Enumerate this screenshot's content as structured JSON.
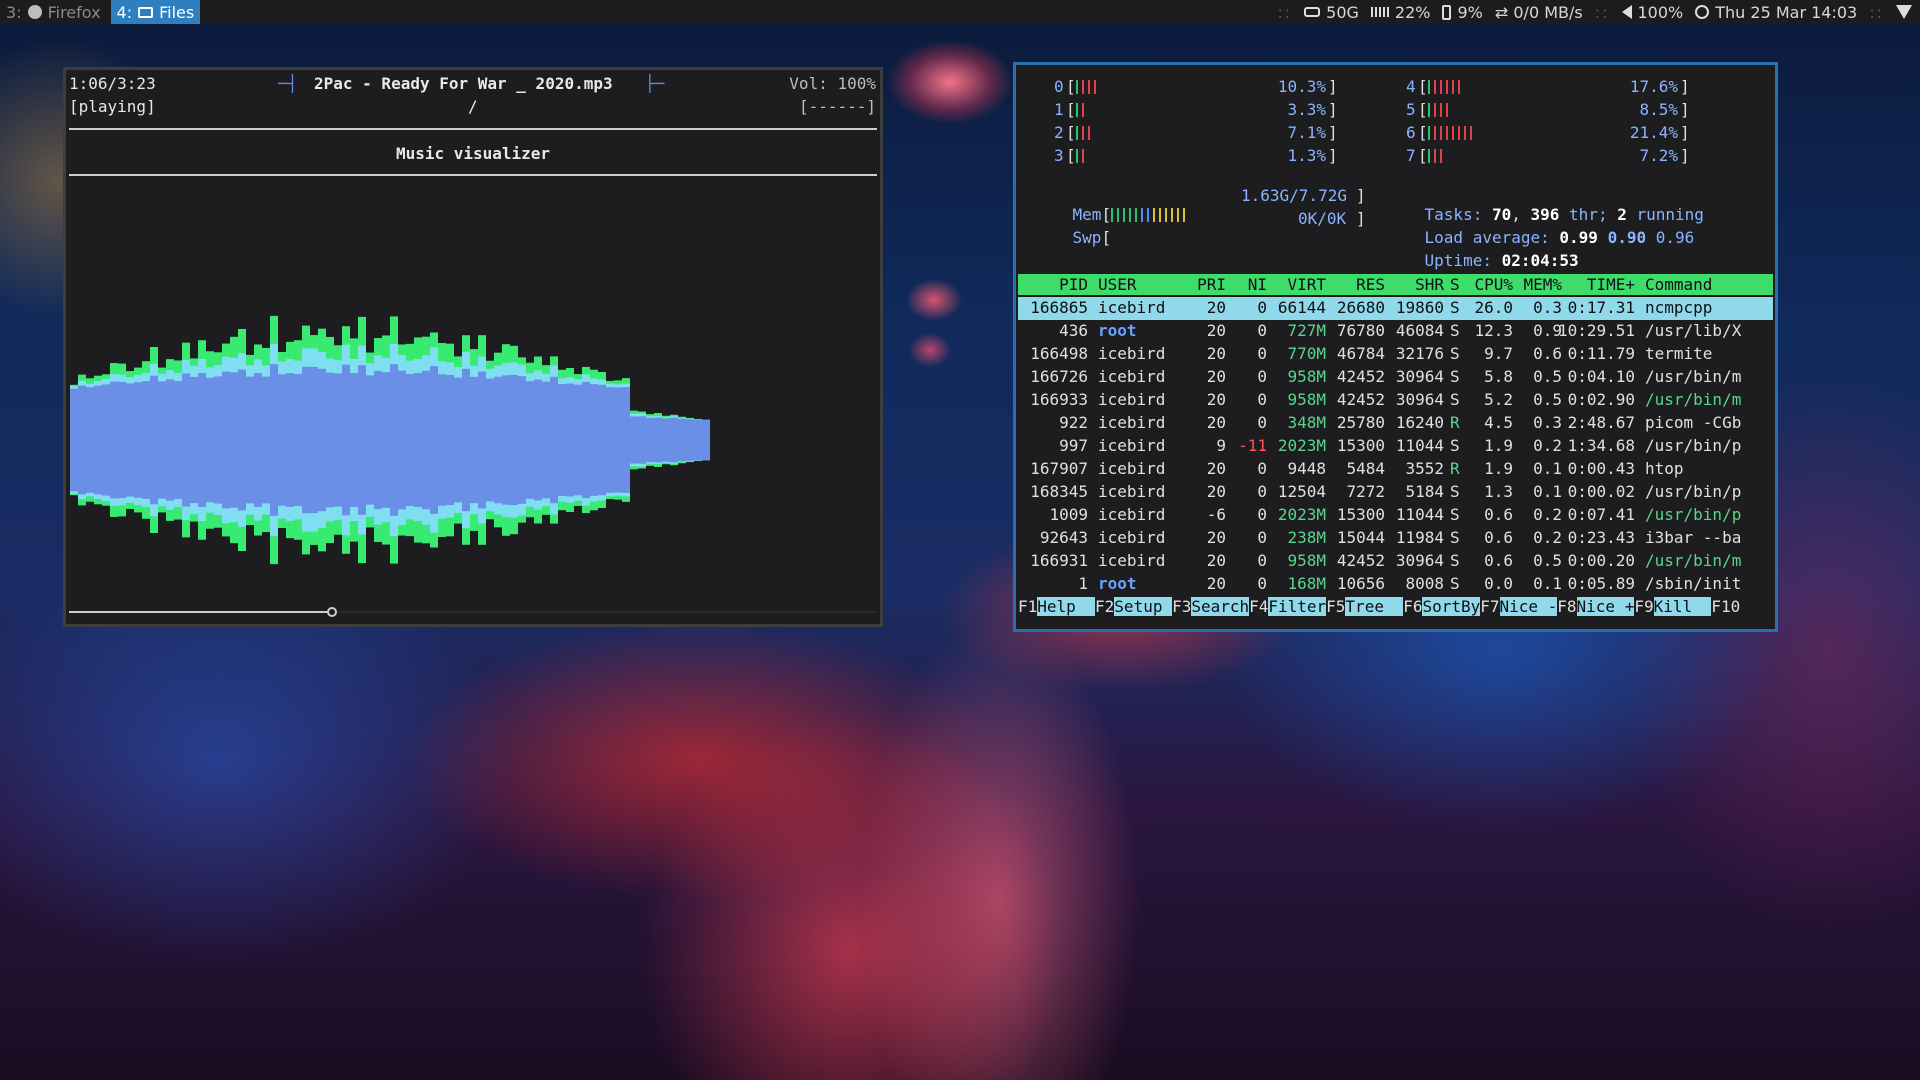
{
  "topbar": {
    "workspaces": [
      {
        "num": "3:",
        "label": "Firefox",
        "icon": "firefox-icon",
        "active": false
      },
      {
        "num": "4:",
        "label": "Files",
        "icon": "folder-icon",
        "active": true
      }
    ],
    "status": {
      "disk": "50G",
      "memory": "22%",
      "battery": "9%",
      "network": "⇄ 0/0 MB/s",
      "volume": "100%",
      "clock": "Thu 25 Mar 14:03"
    }
  },
  "ncmpcpp": {
    "elapsed": "1:06/3:23",
    "state": "[playing]",
    "title": "2Pac - Ready For War _ 2020.mp3",
    "title_left_deco": "─┤",
    "title_right_deco": "├─",
    "volume": "Vol: 100%",
    "slash": "/",
    "flags": "[------]",
    "section_title": "Music visualizer",
    "progress": 0.326,
    "colors": {
      "inner": "#6b8fe6",
      "mid": "#7fdff0",
      "outer": "#39ea72"
    }
  },
  "htop": {
    "cpus_left": [
      {
        "id": "0",
        "bars": [
          "g",
          "r",
          "r",
          "r"
        ],
        "pct": "10.3%"
      },
      {
        "id": "1",
        "bars": [
          "g",
          "r"
        ],
        "pct": "3.3%"
      },
      {
        "id": "2",
        "bars": [
          "g",
          "r",
          "r"
        ],
        "pct": "7.1%"
      },
      {
        "id": "3",
        "bars": [
          "g",
          "r"
        ],
        "pct": "1.3%"
      }
    ],
    "cpus_right": [
      {
        "id": "4",
        "bars": [
          "g",
          "r",
          "r",
          "r",
          "r",
          "r"
        ],
        "pct": "17.6%"
      },
      {
        "id": "5",
        "bars": [
          "g",
          "r",
          "r",
          "r"
        ],
        "pct": "8.5%"
      },
      {
        "id": "6",
        "bars": [
          "g",
          "r",
          "r",
          "r",
          "r",
          "r",
          "r",
          "r"
        ],
        "pct": "21.4%"
      },
      {
        "id": "7",
        "bars": [
          "g",
          "r",
          "r"
        ],
        "pct": "7.2%"
      }
    ],
    "mem": {
      "label": "Mem",
      "bars": [
        "g",
        "g",
        "g",
        "g",
        "g",
        "b",
        "b",
        "y",
        "y",
        "y",
        "y",
        "y",
        "y"
      ],
      "value": "1.63G/7.72G"
    },
    "swp": {
      "label": "Swp",
      "value": "0K/0K"
    },
    "tasks": {
      "label": "Tasks:",
      "count": "70",
      "thr": "396",
      "thr_label": "thr;",
      "running": "2",
      "running_label": "running"
    },
    "load": {
      "label": "Load average:",
      "v1": "0.99",
      "v2": "0.90",
      "v3": "0.96"
    },
    "uptime": {
      "label": "Uptime:",
      "value": "02:04:53"
    },
    "headers": [
      "PID",
      "USER",
      "PRI",
      "NI",
      "VIRT",
      "RES",
      "SHR",
      "S",
      "CPU%",
      "MEM%",
      "TIME+",
      "Command"
    ],
    "processes": [
      {
        "pid": "166865",
        "user": "icebird",
        "pri": "20",
        "ni": "0",
        "virt": "66144",
        "res": "26680",
        "shr": "19860",
        "s": "S",
        "cpu": "26.0",
        "mem": "0.3",
        "time": "0:17.31",
        "cmd": "ncmpcpp",
        "selected": true
      },
      {
        "pid": "436",
        "user": "root",
        "pri": "20",
        "ni": "0",
        "virt": "727M",
        "res": "76780",
        "shr": "46084",
        "s": "S",
        "cpu": "12.3",
        "mem": "0.9",
        "time": "10:29.51",
        "cmd": "/usr/lib/X"
      },
      {
        "pid": "166498",
        "user": "icebird",
        "pri": "20",
        "ni": "0",
        "virt": "770M",
        "res": "46784",
        "shr": "32176",
        "s": "S",
        "cpu": "9.7",
        "mem": "0.6",
        "time": "0:11.79",
        "cmd": "termite"
      },
      {
        "pid": "166726",
        "user": "icebird",
        "pri": "20",
        "ni": "0",
        "virt": "958M",
        "res": "42452",
        "shr": "30964",
        "s": "S",
        "cpu": "5.8",
        "mem": "0.5",
        "time": "0:04.10",
        "cmd": "/usr/bin/m"
      },
      {
        "pid": "166933",
        "user": "icebird",
        "pri": "20",
        "ni": "0",
        "virt": "958M",
        "res": "42452",
        "shr": "30964",
        "s": "S",
        "cpu": "5.2",
        "mem": "0.5",
        "time": "0:02.90",
        "cmd": "/usr/bin/m",
        "green": true
      },
      {
        "pid": "922",
        "user": "icebird",
        "pri": "20",
        "ni": "0",
        "virt": "348M",
        "res": "25780",
        "shr": "16240",
        "s": "R",
        "cpu": "4.5",
        "mem": "0.3",
        "time": "2:48.67",
        "cmd": "picom -CGb"
      },
      {
        "pid": "997",
        "user": "icebird",
        "pri": "9",
        "ni": "-11",
        "virt": "2023M",
        "res": "15300",
        "shr": "11044",
        "s": "S",
        "cpu": "1.9",
        "mem": "0.2",
        "time": "1:34.68",
        "cmd": "/usr/bin/p"
      },
      {
        "pid": "167907",
        "user": "icebird",
        "pri": "20",
        "ni": "0",
        "virt": "9448",
        "res": "5484",
        "shr": "3552",
        "s": "R",
        "cpu": "1.9",
        "mem": "0.1",
        "time": "0:00.43",
        "cmd": "htop"
      },
      {
        "pid": "168345",
        "user": "icebird",
        "pri": "20",
        "ni": "0",
        "virt": "12504",
        "res": "7272",
        "shr": "5184",
        "s": "S",
        "cpu": "1.3",
        "mem": "0.1",
        "time": "0:00.02",
        "cmd": "/usr/bin/p"
      },
      {
        "pid": "1009",
        "user": "icebird",
        "pri": "-6",
        "ni": "0",
        "virt": "2023M",
        "res": "15300",
        "shr": "11044",
        "s": "S",
        "cpu": "0.6",
        "mem": "0.2",
        "time": "0:07.41",
        "cmd": "/usr/bin/p",
        "green": true
      },
      {
        "pid": "92643",
        "user": "icebird",
        "pri": "20",
        "ni": "0",
        "virt": "238M",
        "res": "15044",
        "shr": "11984",
        "s": "S",
        "cpu": "0.6",
        "mem": "0.2",
        "time": "0:23.43",
        "cmd": "i3bar --ba"
      },
      {
        "pid": "166931",
        "user": "icebird",
        "pri": "20",
        "ni": "0",
        "virt": "958M",
        "res": "42452",
        "shr": "30964",
        "s": "S",
        "cpu": "0.6",
        "mem": "0.5",
        "time": "0:00.20",
        "cmd": "/usr/bin/m",
        "green": true
      },
      {
        "pid": "1",
        "user": "root",
        "pri": "20",
        "ni": "0",
        "virt": "168M",
        "res": "10656",
        "shr": "8008",
        "s": "S",
        "cpu": "0.0",
        "mem": "0.1",
        "time": "0:05.89",
        "cmd": "/sbin/init"
      }
    ],
    "fkeys": [
      {
        "key": "F1",
        "label": "Help  "
      },
      {
        "key": "F2",
        "label": "Setup "
      },
      {
        "key": "F3",
        "label": "Search"
      },
      {
        "key": "F4",
        "label": "Filter"
      },
      {
        "key": "F5",
        "label": "Tree  "
      },
      {
        "key": "F6",
        "label": "SortBy"
      },
      {
        "key": "F7",
        "label": "Nice -"
      },
      {
        "key": "F8",
        "label": "Nice +"
      },
      {
        "key": "F9",
        "label": "Kill  "
      },
      {
        "key": "F10",
        "label": ""
      }
    ]
  }
}
